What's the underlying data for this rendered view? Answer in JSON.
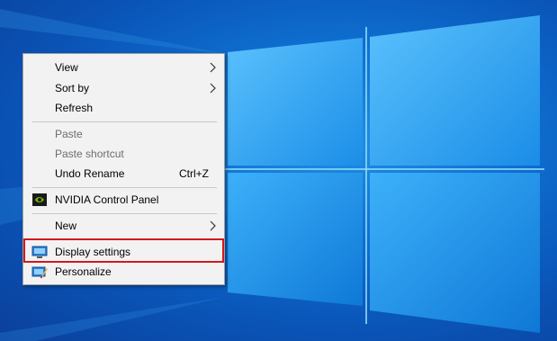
{
  "desktop": {
    "accent": "#0e6fd0"
  },
  "context_menu": {
    "items": [
      {
        "label": "View",
        "submenu": true
      },
      {
        "label": "Sort by",
        "submenu": true
      },
      {
        "label": "Refresh"
      },
      {
        "label": "Paste",
        "disabled": true
      },
      {
        "label": "Paste shortcut",
        "disabled": true
      },
      {
        "label": "Undo Rename",
        "shortcut": "Ctrl+Z"
      },
      {
        "label": "NVIDIA Control Panel",
        "icon": "nvidia-icon"
      },
      {
        "label": "New",
        "submenu": true
      },
      {
        "label": "Display settings",
        "icon": "display-icon",
        "highlighted": true
      },
      {
        "label": "Personalize",
        "icon": "personalize-icon"
      }
    ],
    "highlight_color": "#d4171a"
  }
}
